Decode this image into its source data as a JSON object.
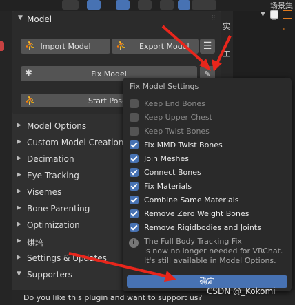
{
  "top_right": {
    "label": "场景集合"
  },
  "model_panel": {
    "title": "Model",
    "import_label": "Import Model",
    "export_label": "Export Model",
    "fix_label": "Fix Model",
    "start_pose_label": "Start Pose"
  },
  "sections": [
    {
      "label": "Model Options"
    },
    {
      "label": "Custom Model Creation"
    },
    {
      "label": "Decimation"
    },
    {
      "label": "Eye Tracking"
    },
    {
      "label": "Visemes"
    },
    {
      "label": "Bone Parenting"
    },
    {
      "label": "Optimization"
    },
    {
      "label": "烘培"
    },
    {
      "label": "Settings & Updates"
    },
    {
      "label": "Supporters"
    }
  ],
  "bottom_text": "Do you like this plugin and want to support us?",
  "popup": {
    "title": "Fix Model Settings",
    "options": [
      {
        "label": "Keep End Bones",
        "checked": false
      },
      {
        "label": "Keep Upper Chest",
        "checked": false
      },
      {
        "label": "Keep Twist Bones",
        "checked": false
      },
      {
        "label": "Fix MMD Twist Bones",
        "checked": true
      },
      {
        "label": "Join Meshes",
        "checked": true
      },
      {
        "label": "Connect Bones",
        "checked": true
      },
      {
        "label": "Fix Materials",
        "checked": true
      },
      {
        "label": "Combine Same Materials",
        "checked": true
      },
      {
        "label": "Remove Zero Weight Bones",
        "checked": true
      },
      {
        "label": "Remove Rigidbodies and Joints",
        "checked": true
      }
    ],
    "note_lines": [
      "The Full Body Tracking Fix",
      "is now no longer needed for VRChat.",
      "It's still available in Model Options."
    ],
    "ok_label": "确定"
  },
  "side_tabs": [
    "实",
    "工"
  ],
  "watermark": "CSDN @_Kokomi",
  "colors": {
    "accent": "#4772b3",
    "arrow": "#e8261c"
  }
}
